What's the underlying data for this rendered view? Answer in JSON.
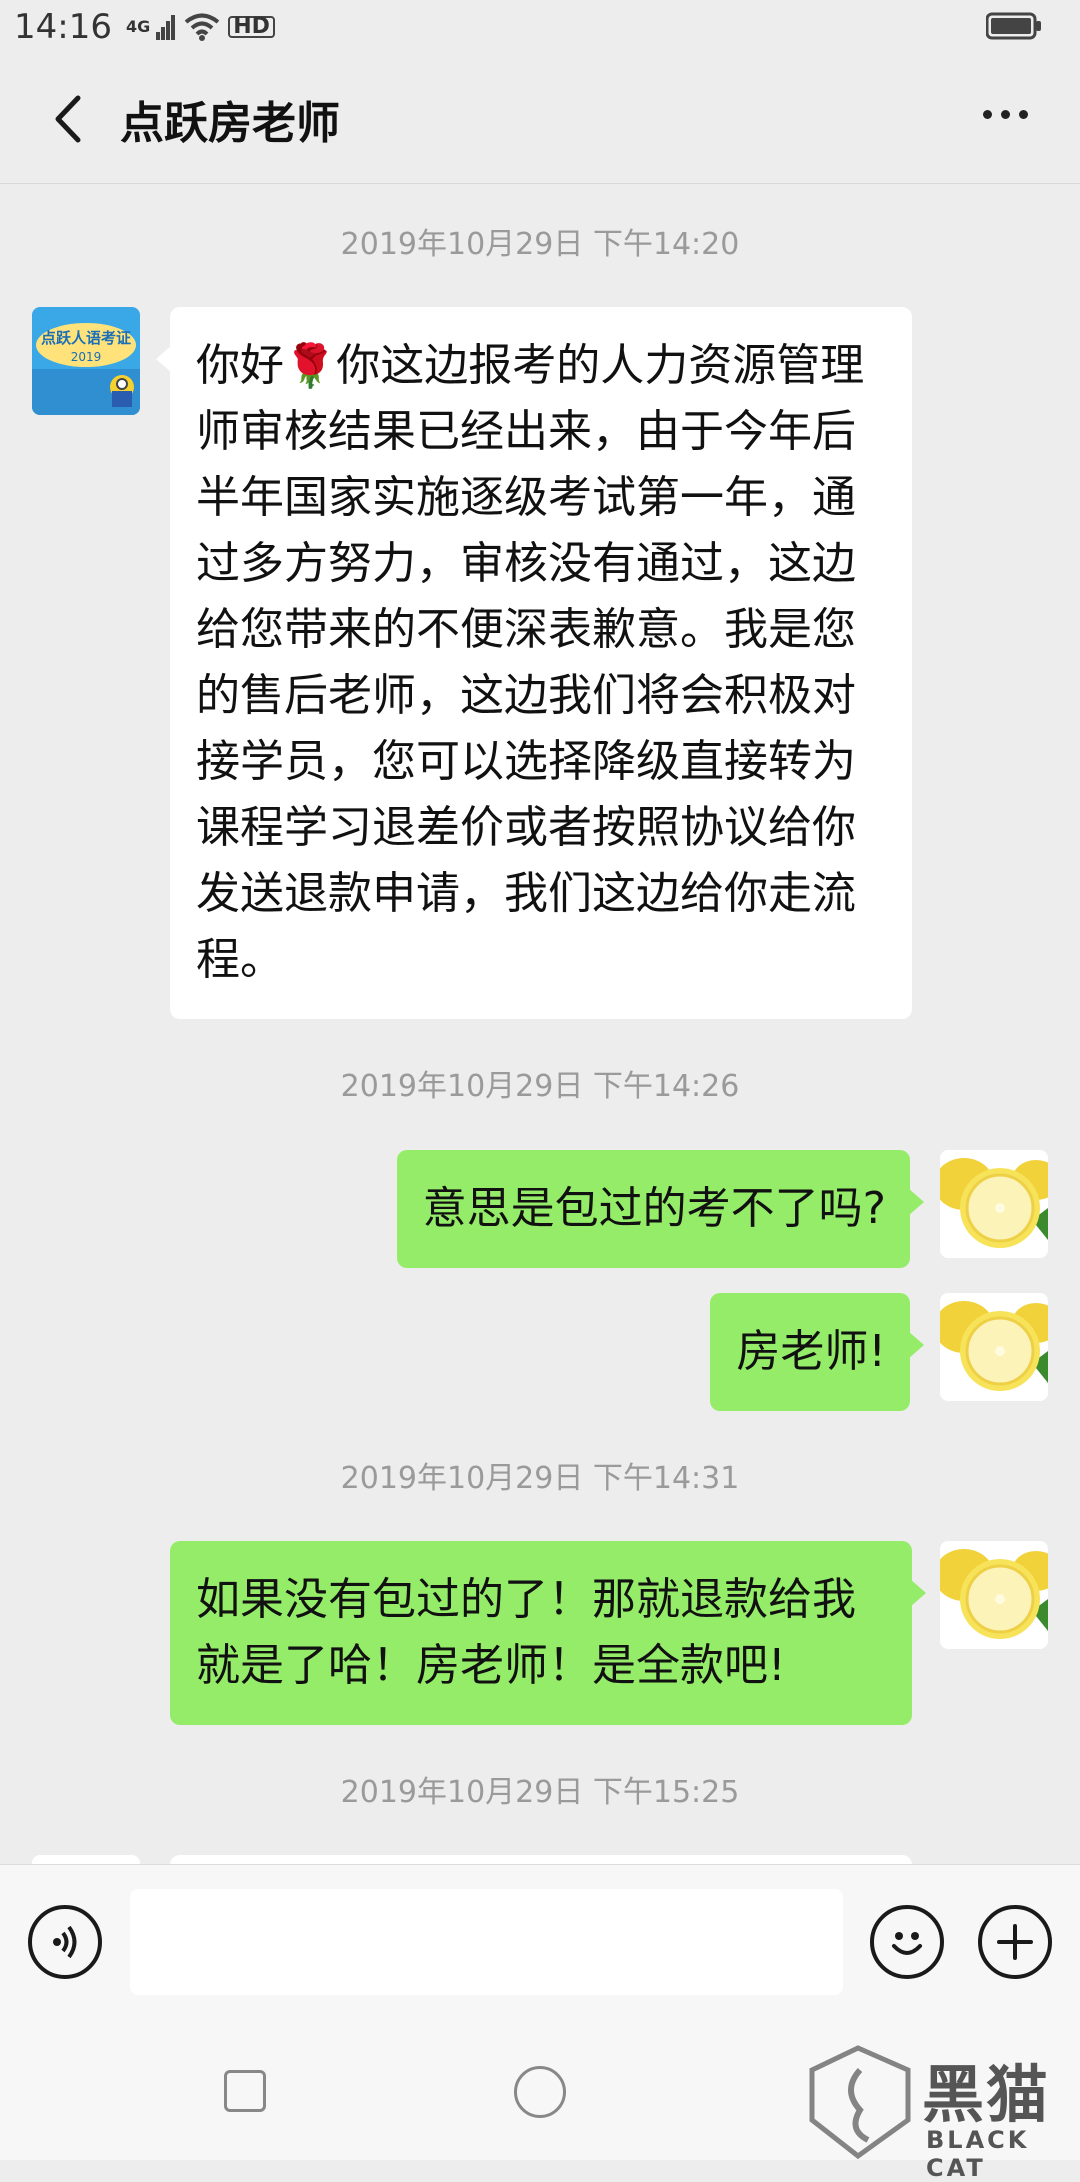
{
  "status": {
    "time": "14:16",
    "network": "4G",
    "hd": "HD"
  },
  "header": {
    "title": "点跃房老师"
  },
  "messages": [
    {
      "type": "timestamp",
      "text": "2019年10月29日 下午14:20"
    },
    {
      "type": "incoming",
      "emoji": "🌹",
      "text_before": "你好",
      "text_after": "你这边报考的人力资源管理师审核结果已经出来，由于今年后半年国家实施逐级考试第一年，通过多方努力，审核没有通过，这边给您带来的不便深表歉意。我是您的售后老师，这边我们将会积极对接学员，您可以选择降级直接转为课程学习退差价或者按照协议给你发送退款申请，我们这边给你走流程。"
    },
    {
      "type": "timestamp",
      "text": "2019年10月29日 下午14:26"
    },
    {
      "type": "outgoing",
      "text": "意思是包过的考不了吗?"
    },
    {
      "type": "outgoing",
      "text": "房老师!"
    },
    {
      "type": "timestamp",
      "text": "2019年10月29日 下午14:31"
    },
    {
      "type": "outgoing",
      "text": "如果没有包过的了！那就退款给我就是了哈！房老师！是全款吧!"
    },
    {
      "type": "timestamp",
      "text": "2019年10月29日 下午15:25"
    }
  ],
  "avatar_incoming": {
    "banner": "点跃人语考证",
    "year": "2019"
  },
  "watermark": {
    "text": "黑猫",
    "sub": "BLACK CAT"
  },
  "colors": {
    "background": "#ededed",
    "outgoing_bubble": "#95ec69",
    "incoming_bubble": "#ffffff"
  },
  "icons": [
    "back-arrow-icon",
    "more-icon",
    "voice-icon",
    "emoji-icon",
    "plus-icon",
    "wifi-icon",
    "battery-icon"
  ]
}
